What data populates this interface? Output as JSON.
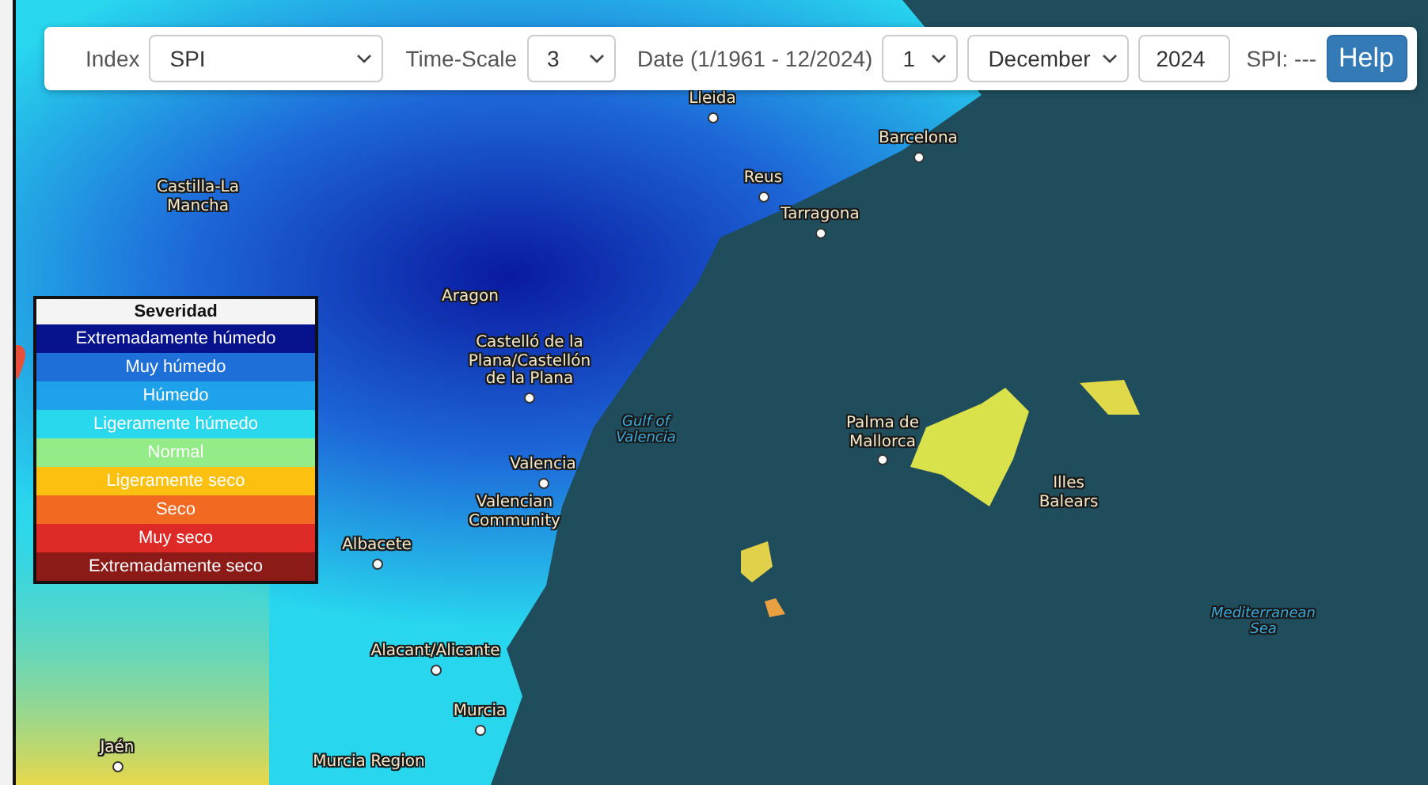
{
  "toolbar": {
    "index": {
      "label": "Index",
      "value": "SPI"
    },
    "time_scale": {
      "label": "Time-Scale",
      "value": "3"
    },
    "date": {
      "label": "Date (1/1961 - 12/2024)",
      "month_number": "1",
      "month_name": "December",
      "year": "2024"
    },
    "reading": "SPI: ---",
    "help_button": "Help"
  },
  "legend": {
    "title": "Severidad",
    "items": [
      {
        "label": "Extremadamente húmedo",
        "color": "#07138c"
      },
      {
        "label": "Muy húmedo",
        "color": "#1f6fd8"
      },
      {
        "label": "Húmedo",
        "color": "#1fa2ec"
      },
      {
        "label": "Ligeramente húmedo",
        "color": "#2ad8ee"
      },
      {
        "label": "Normal",
        "color": "#93ec88"
      },
      {
        "label": "Ligeramente seco",
        "color": "#fcc010"
      },
      {
        "label": "Seco",
        "color": "#f26a22"
      },
      {
        "label": "Muy seco",
        "color": "#de2a26"
      },
      {
        "label": "Extremadamente seco",
        "color": "#8c1b18"
      }
    ]
  },
  "map_labels": [
    {
      "text": "Castilla-La Mancha",
      "kind": "region"
    },
    {
      "text": "Lleida",
      "kind": "city"
    },
    {
      "text": "Barcelona",
      "kind": "city"
    },
    {
      "text": "Reus",
      "kind": "city"
    },
    {
      "text": "Tarragona",
      "kind": "city"
    },
    {
      "text": "Aragon",
      "kind": "region"
    },
    {
      "text": "Castelló de la Plana/Castellón de la Plana",
      "kind": "city"
    },
    {
      "text": "Gulf of Valencia",
      "kind": "sea"
    },
    {
      "text": "Valencia",
      "kind": "city"
    },
    {
      "text": "Valencian Community",
      "kind": "region"
    },
    {
      "text": "Albacete",
      "kind": "city"
    },
    {
      "text": "Palma de Mallorca",
      "kind": "city"
    },
    {
      "text": "Illes Balears",
      "kind": "region"
    },
    {
      "text": "Alacant/Alicante",
      "kind": "city"
    },
    {
      "text": "Mediterranean Sea",
      "kind": "sea"
    },
    {
      "text": "Murcia",
      "kind": "city"
    },
    {
      "text": "Jaén",
      "kind": "city"
    },
    {
      "text": "Murcia Region",
      "kind": "region"
    }
  ]
}
